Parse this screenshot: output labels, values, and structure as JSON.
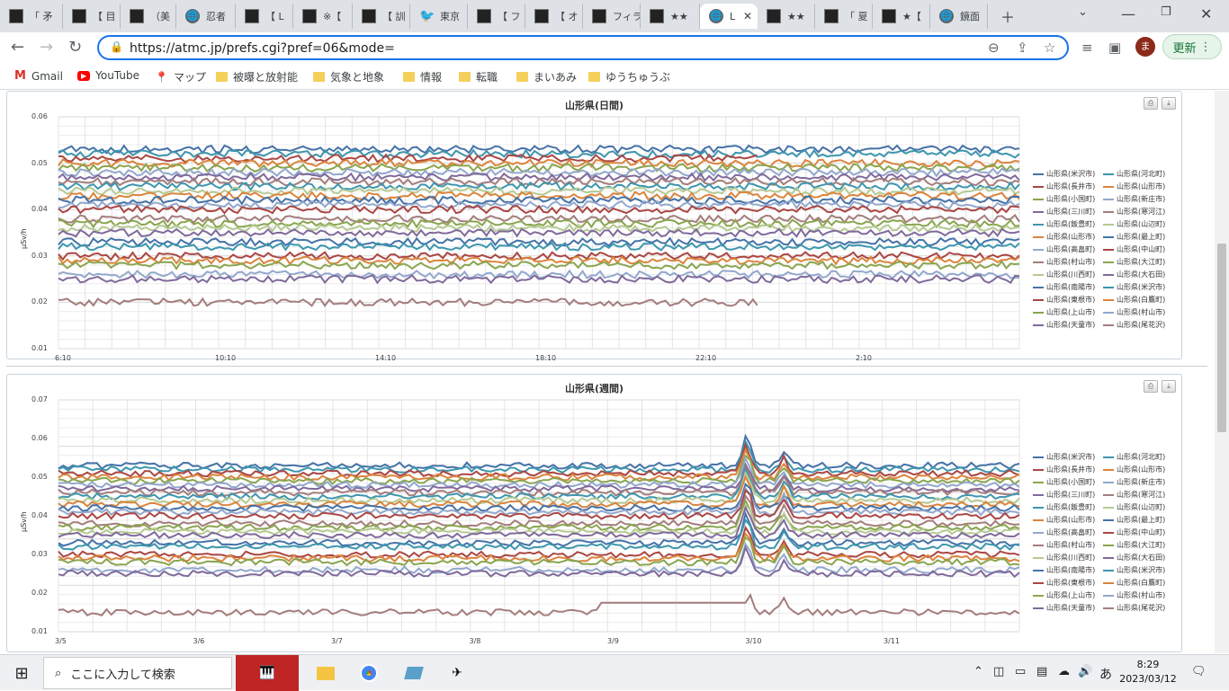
{
  "tabs": [
    {
      "label": "「 矛",
      "icon": "dark"
    },
    {
      "label": "【 目",
      "icon": "dark"
    },
    {
      "label": "（美",
      "icon": "dark"
    },
    {
      "label": "忍者",
      "icon": "globe"
    },
    {
      "label": "【 L",
      "icon": "dark"
    },
    {
      "label": "※【",
      "icon": "dark"
    },
    {
      "label": "【 訓",
      "icon": "dark"
    },
    {
      "label": "東京",
      "icon": "twitter"
    },
    {
      "label": "【 フ",
      "icon": "dark"
    },
    {
      "label": "【 オ",
      "icon": "dark"
    },
    {
      "label": "フィラ",
      "icon": "dark"
    },
    {
      "label": "★★",
      "icon": "dark"
    },
    {
      "label": "L",
      "icon": "globe",
      "active": true
    },
    {
      "label": "★★",
      "icon": "dark"
    },
    {
      "label": "「 夏",
      "icon": "dark"
    },
    {
      "label": "★【",
      "icon": "dark"
    },
    {
      "label": "鏡面",
      "icon": "globe"
    }
  ],
  "browser": {
    "url": "https://atmc.jp/prefs.cgi?pref=06&mode=",
    "avatar": "ま",
    "update_label": "更新"
  },
  "bookmarks": [
    {
      "label": "Gmail",
      "icon": "gmail-icon"
    },
    {
      "label": "YouTube",
      "icon": "youtube-icon"
    },
    {
      "label": "マップ",
      "icon": "maps-icon"
    },
    {
      "label": "被曝と放射能",
      "icon": "folder-icon"
    },
    {
      "label": "気象と地象",
      "icon": "folder-icon"
    },
    {
      "label": "情報",
      "icon": "folder-icon"
    },
    {
      "label": "転職",
      "icon": "folder-icon"
    },
    {
      "label": "まいあみ",
      "icon": "folder-icon"
    },
    {
      "label": "ゆうちゅうぶ",
      "icon": "folder-icon"
    }
  ],
  "legend_items": [
    {
      "label": "山形県(米沢市)",
      "color": "#4572a7"
    },
    {
      "label": "山形県(河北町)",
      "color": "#3d96ae"
    },
    {
      "label": "山形県(長井市)",
      "color": "#aa4643"
    },
    {
      "label": "山形県(山形市)",
      "color": "#db843d"
    },
    {
      "label": "山形県(小国町)",
      "color": "#89a54e"
    },
    {
      "label": "山形県(新庄市)",
      "color": "#92a8cd"
    },
    {
      "label": "山形県(三川町)",
      "color": "#80699b"
    },
    {
      "label": "山形県(寒河江)",
      "color": "#a47d7c"
    },
    {
      "label": "山形県(飯豊町)",
      "color": "#3d96ae"
    },
    {
      "label": "山形県(山辺町)",
      "color": "#b5ca92"
    },
    {
      "label": "山形県(山形市)",
      "color": "#db843d"
    },
    {
      "label": "山形県(最上町)",
      "color": "#4572a7"
    },
    {
      "label": "山形県(高畠町)",
      "color": "#92a8cd"
    },
    {
      "label": "山形県(中山町)",
      "color": "#aa4643"
    },
    {
      "label": "山形県(村山市)",
      "color": "#a47d7c"
    },
    {
      "label": "山形県(大江町)",
      "color": "#89a54e"
    },
    {
      "label": "山形県(川西町)",
      "color": "#b5ca92"
    },
    {
      "label": "山形県(大石田)",
      "color": "#80699b"
    },
    {
      "label": "山形県(南陽市)",
      "color": "#4572a7"
    },
    {
      "label": "山形県(米沢市)",
      "color": "#3d96ae"
    },
    {
      "label": "山形県(東根市)",
      "color": "#aa4643"
    },
    {
      "label": "山形県(白鷹町)",
      "color": "#db843d"
    },
    {
      "label": "山形県(上山市)",
      "color": "#89a54e"
    },
    {
      "label": "山形県(村山市)",
      "color": "#92a8cd"
    },
    {
      "label": "山形県(天童市)",
      "color": "#80699b"
    },
    {
      "label": "山形県(尾花沢)",
      "color": "#a47d7c"
    }
  ],
  "chart_data": [
    {
      "type": "line",
      "title": "山形県(日間)",
      "ylabel": "μSv/h",
      "ylim": [
        0.01,
        0.06
      ],
      "yticks": [
        "0.06",
        "0.05",
        "0.04",
        "0.03",
        "0.02",
        "0.01"
      ],
      "xticks": [
        "6:10",
        "10:10",
        "14:10",
        "18:10",
        "22:10",
        "2:10"
      ],
      "series_levels": [
        0.053,
        0.052,
        0.051,
        0.05,
        0.049,
        0.048,
        0.047,
        0.046,
        0.045,
        0.044,
        0.043,
        0.042,
        0.041,
        0.04,
        0.038,
        0.037,
        0.036,
        0.035,
        0.033,
        0.032,
        0.03,
        0.029,
        0.028,
        0.026,
        0.025,
        0.02
      ],
      "grid": true,
      "legend": "right"
    },
    {
      "type": "line",
      "title": "山形県(週間)",
      "ylabel": "μSv/h",
      "ylim": [
        0.01,
        0.07
      ],
      "yticks": [
        "0.07",
        "0.06",
        "0.05",
        "0.04",
        "0.03",
        "0.02",
        "0.01"
      ],
      "xticks": [
        "3/5",
        "3/6",
        "3/7",
        "3/8",
        "3/9",
        "3/10",
        "3/11"
      ],
      "series_levels": [
        0.053,
        0.052,
        0.051,
        0.05,
        0.049,
        0.048,
        0.047,
        0.046,
        0.045,
        0.044,
        0.043,
        0.042,
        0.041,
        0.04,
        0.038,
        0.037,
        0.036,
        0.035,
        0.033,
        0.032,
        0.03,
        0.029,
        0.028,
        0.026,
        0.025,
        0.015
      ],
      "grid": true,
      "legend": "right"
    }
  ],
  "taskbar": {
    "search_placeholder": "ここに入力して検索",
    "time": "8:29",
    "date": "2023/03/12",
    "ime": "あ"
  }
}
